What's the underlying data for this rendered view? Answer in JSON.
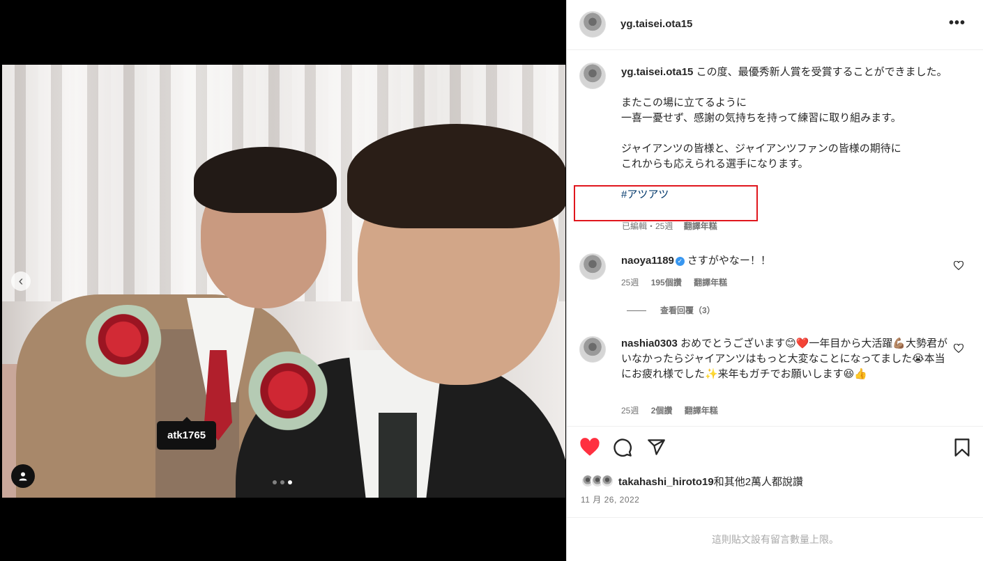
{
  "photo": {
    "tag_username": "atk1765",
    "carousel": {
      "total": 3,
      "active_index": 3
    }
  },
  "header": {
    "username": "yg.taisei.ota15",
    "more_icon": "more-horizontal-icon"
  },
  "caption": {
    "username": "yg.taisei.ota15",
    "lines": [
      "この度、最優秀新人賞を受賞することができました。",
      "",
      "またこの場に立てるように",
      "一喜一憂せず、感謝の気持ちを持って練習に取り組みます。",
      "",
      "ジャイアンツの皆様と、ジャイアンツファンの皆様の期待に",
      "これからも応えられる選手になります。",
      ""
    ],
    "hashtag": "#アツアツ",
    "meta": "已編輯・25週",
    "translate": "翻譯年糕"
  },
  "comments": [
    {
      "username": "naoya1189",
      "verified": true,
      "text": "さすがやなー！！",
      "age": "25週",
      "likes": "195個讚",
      "translate": "翻譯年糕",
      "view_replies": "查看回覆（3）"
    },
    {
      "username": "nashia0303",
      "verified": false,
      "text": "おめでとうございます😊❤️一年目から大活躍💪🏽大勢君がいなかったらジャイアンツはもっと大変なことになってました😭本当にお疲れ様でした✨来年もガチでお願いします😆👍",
      "age": "25週",
      "likes": "2個讚",
      "translate": "翻譯年糕"
    }
  ],
  "actions": {
    "like_icon": "heart-filled-icon",
    "comment_icon": "comment-icon",
    "share_icon": "share-icon",
    "save_icon": "bookmark-icon",
    "like_color": "#ff3040"
  },
  "likes": {
    "user": "takahashi_hiroto19",
    "rest": "和其他2萬人都說讚"
  },
  "date": "11 月 26, 2022",
  "footer": "這則貼文設有留言數量上限。"
}
